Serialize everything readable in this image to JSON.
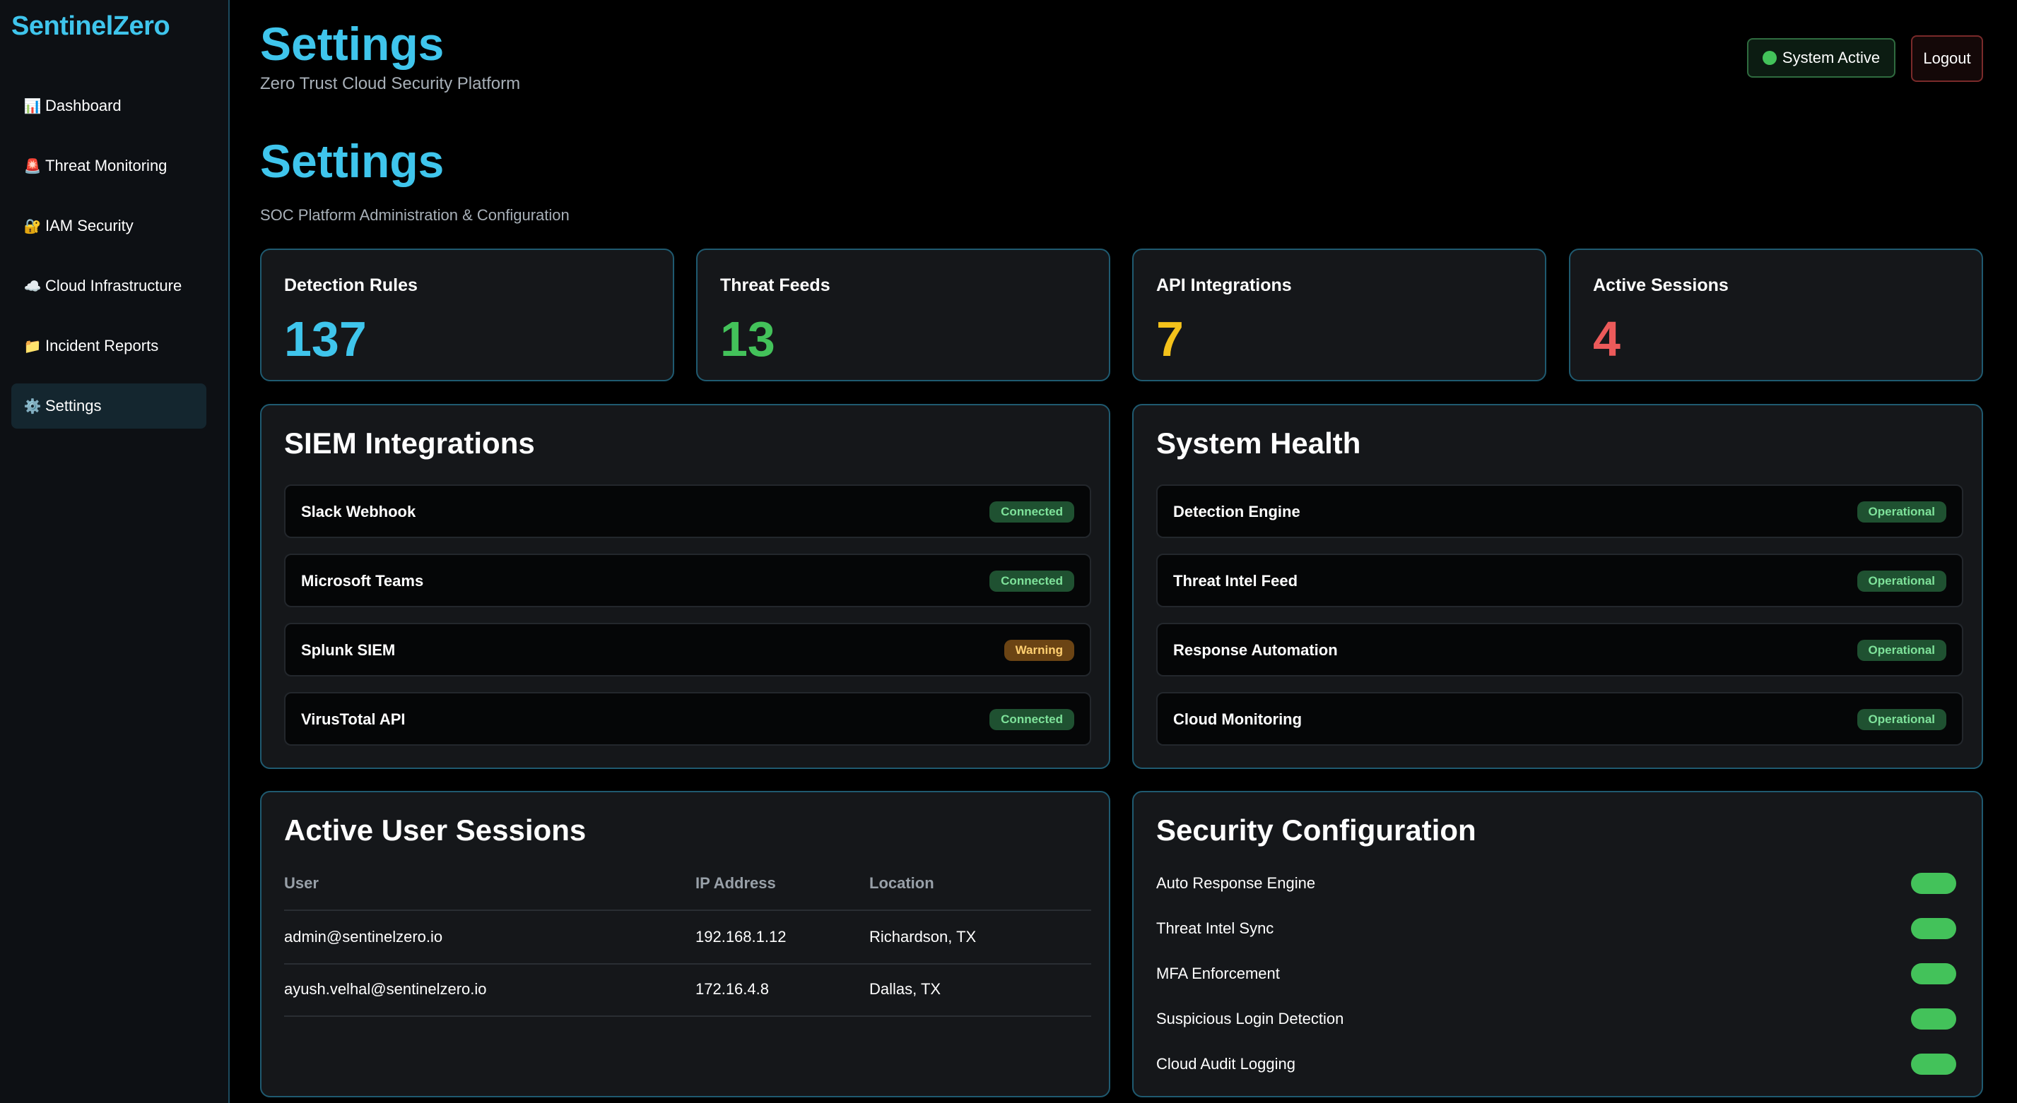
{
  "sidebar": {
    "brand": "SentinelZero",
    "items": [
      {
        "icon": "📊",
        "label": "Dashboard"
      },
      {
        "icon": "🚨",
        "label": "Threat Monitoring"
      },
      {
        "icon": "🔐",
        "label": "IAM Security"
      },
      {
        "icon": "☁️",
        "label": "Cloud Infrastructure"
      },
      {
        "icon": "📁",
        "label": "Incident Reports"
      },
      {
        "icon": "⚙️",
        "label": "Settings"
      }
    ]
  },
  "header": {
    "title": "Settings",
    "subtitle": "Zero Trust Cloud Security Platform",
    "status_label": "System Active",
    "logout_label": "Logout"
  },
  "page": {
    "title": "Settings",
    "subtitle": "SOC Platform Administration & Configuration"
  },
  "stats": [
    {
      "label": "Detection Rules",
      "value": "137",
      "color": "#3fc5ec"
    },
    {
      "label": "Threat Feeds",
      "value": "13",
      "color": "#43c25a"
    },
    {
      "label": "API Integrations",
      "value": "7",
      "color": "#f4c21b"
    },
    {
      "label": "Active Sessions",
      "value": "4",
      "color": "#ec5a5a"
    }
  ],
  "siem": {
    "title": "SIEM Integrations",
    "items": [
      {
        "name": "Slack Webhook",
        "status": "Connected"
      },
      {
        "name": "Microsoft Teams",
        "status": "Connected"
      },
      {
        "name": "Splunk SIEM",
        "status": "Warning"
      },
      {
        "name": "VirusTotal API",
        "status": "Connected"
      }
    ]
  },
  "health": {
    "title": "System Health",
    "items": [
      {
        "name": "Detection Engine",
        "status": "Operational"
      },
      {
        "name": "Threat Intel Feed",
        "status": "Operational"
      },
      {
        "name": "Response Automation",
        "status": "Operational"
      },
      {
        "name": "Cloud Monitoring",
        "status": "Operational"
      }
    ]
  },
  "sessions": {
    "title": "Active User Sessions",
    "columns": [
      "User",
      "IP Address",
      "Location"
    ],
    "rows": [
      [
        "admin@sentinelzero.io",
        "192.168.1.12",
        "Richardson, TX"
      ],
      [
        "ayush.velhal@sentinelzero.io",
        "172.16.4.8",
        "Dallas, TX"
      ]
    ]
  },
  "security": {
    "title": "Security Configuration",
    "items": [
      {
        "label": "Auto Response Engine",
        "enabled": true
      },
      {
        "label": "Threat Intel Sync",
        "enabled": true
      },
      {
        "label": "MFA Enforcement",
        "enabled": true
      },
      {
        "label": "Suspicious Login Detection",
        "enabled": true
      },
      {
        "label": "Cloud Audit Logging",
        "enabled": true
      }
    ]
  },
  "colors": {
    "accent": "#3fc5ec",
    "ok": "#43c25a",
    "warn": "#f4c21b",
    "danger": "#ec5a5a"
  }
}
